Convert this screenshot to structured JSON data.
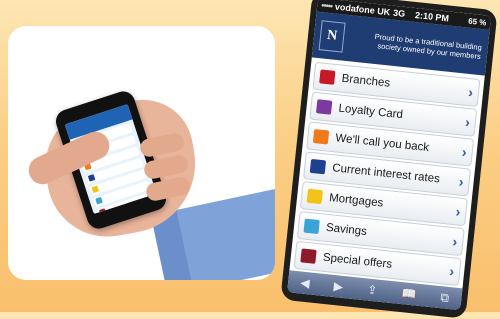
{
  "status": {
    "signal": "•••••",
    "carrier": "vodafone UK",
    "network": "3G",
    "time": "2:10 PM",
    "battery": "65 %"
  },
  "header": {
    "logo_text": "N",
    "tagline": "Proud to be a traditional building society owned by our members"
  },
  "menu": {
    "items": [
      {
        "label": "Branches",
        "color": "#c8192b"
      },
      {
        "label": "Loyalty Card",
        "color": "#7b3aa0"
      },
      {
        "label": "We'll call you back",
        "color": "#f07a1a"
      },
      {
        "label": "Current interest rates",
        "color": "#1f3f8f"
      },
      {
        "label": "Mortgages",
        "color": "#f4c318"
      },
      {
        "label": "Savings",
        "color": "#3aa3d8"
      },
      {
        "label": "Special offers",
        "color": "#8f1a28"
      }
    ],
    "chevron": "›"
  },
  "toolbar": {
    "back": "◀",
    "forward": "▶",
    "share": "⇪",
    "bookmarks": "📖",
    "pages": "⧉"
  },
  "colors": {
    "background": "#fbcf86",
    "header": "#1f3d73",
    "chevron": "#2b5aa6"
  }
}
